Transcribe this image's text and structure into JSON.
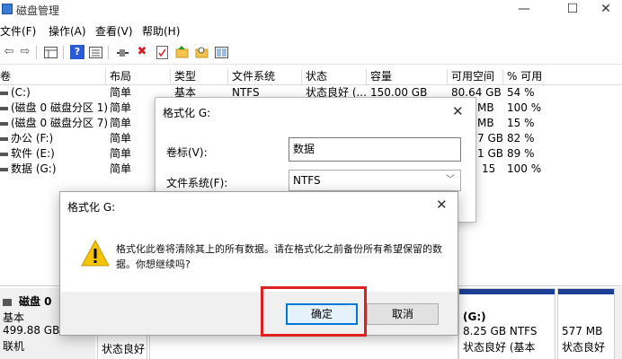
{
  "window": {
    "title": "磁盘管理",
    "minimize": "—",
    "maximize": "☐",
    "close": "✕"
  },
  "menu": [
    {
      "label": "文件(F)"
    },
    {
      "label": "操作(A)"
    },
    {
      "label": "查看(V)"
    },
    {
      "label": "帮助(H)"
    }
  ],
  "toolbar": {
    "icons": [
      "back-arrow-icon",
      "forward-arrow-icon",
      "properties-grid-icon",
      "help-icon",
      "list-view-icon",
      "connect-icon",
      "delete-x-icon",
      "checklist-icon",
      "folder-up-icon",
      "search-icon",
      "panels-icon"
    ],
    "back": "⇦",
    "forward": "⇨",
    "delete": "✖",
    "help": "?"
  },
  "volume_table": {
    "headers": [
      "卷",
      "布局",
      "类型",
      "文件系统",
      "状态",
      "容量",
      "可用空间",
      "% 可用"
    ],
    "rows": [
      [
        "(C:)",
        "简单",
        "基本",
        "NTFS",
        "状态良好 (...",
        "150.00 GB",
        "80.64 GB",
        "54 %"
      ],
      [
        "(磁盘 0 磁盘分区 1)",
        "简单",
        "",
        "",
        "",
        "",
        "MB",
        "100 %"
      ],
      [
        "(磁盘 0 磁盘分区 7)",
        "简单",
        "",
        "",
        "",
        "",
        "MB",
        "15 %"
      ],
      [
        "办公 (F:)",
        "简单",
        "",
        "",
        "",
        "",
        "7 GB",
        "82 %"
      ],
      [
        "软件 (E:)",
        "简单",
        "",
        "",
        "",
        "",
        "1 GB",
        "89 %"
      ],
      [
        "数据 (G:)",
        "简单",
        "",
        "",
        "",
        "",
        "15",
        "100 %"
      ]
    ]
  },
  "disk_view": {
    "disk_name": "磁盘 0",
    "disk_type": "基本",
    "disk_size": "499.88 GB",
    "disk_status": "联机",
    "partition_left_status": "状态良好",
    "partition_g_label": "(G:)",
    "partition_g_size": "8.25 GB NTFS",
    "partition_g_status": "状态良好 (基本",
    "partition_last_size": "577 MB",
    "partition_last_status": "状态良好"
  },
  "format_dialog": {
    "title": "格式化 G:",
    "close": "✕",
    "volume_label_label": "卷标(V):",
    "volume_label_value": "数据",
    "filesystem_label": "文件系统(F):",
    "filesystem_value": "NTFS"
  },
  "confirm_dialog": {
    "title": "格式化 G:",
    "close": "✕",
    "message": "格式化此卷将清除其上的所有数据。请在格式化之前备份所有希望保留的数据。你想继续吗?",
    "ok_label": "确定",
    "cancel_label": "取消"
  },
  "colors": {
    "partition_bar": "#1c3f95",
    "highlight": "#e02020",
    "primary_border": "#0078d7",
    "warning": "#f5c400"
  }
}
